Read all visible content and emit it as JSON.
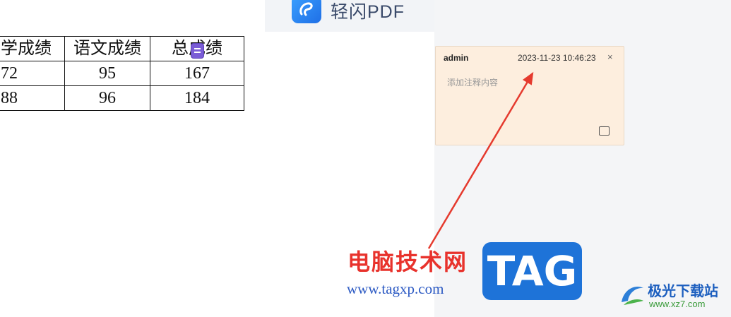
{
  "app": {
    "name": "轻闪PDF"
  },
  "table": {
    "rows": [
      [
        "学成绩",
        "语文成绩",
        "总成绩"
      ],
      [
        "72",
        "95",
        "167"
      ],
      [
        "88",
        "96",
        "184"
      ]
    ]
  },
  "comment": {
    "author": "admin",
    "timestamp": "2023-11-23 10:46:23",
    "close_symbol": "×",
    "placeholder": "添加注释内容"
  },
  "watermark": {
    "site_title": "电脑技术网",
    "site_url": "www.tagxp.com",
    "tag_text": "TAG",
    "brand_name": "极光下载站",
    "brand_url": "www.xz7.com"
  },
  "colors": {
    "comment_bg": "#fdeede",
    "annotation_arrow": "#e53a2e",
    "marker": "#7a5cd6",
    "tag_blue": "#1e73d8"
  }
}
